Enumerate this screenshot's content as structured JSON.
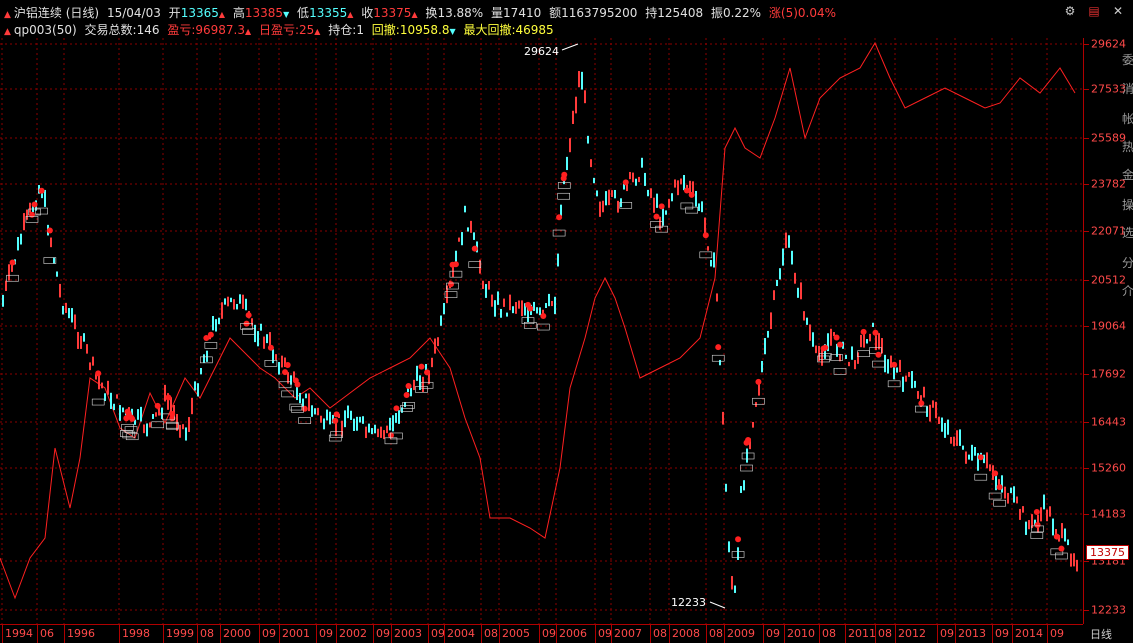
{
  "header": {
    "title": "沪铝连续 (日线)",
    "date": "15/04/03",
    "open_label": "开",
    "open": "13365",
    "high_label": "高",
    "high": "13385",
    "low_label": "低",
    "low": "13355",
    "close_label": "收",
    "close": "13375",
    "turnover_label": "换",
    "turnover": "13.88%",
    "volume_label": "量",
    "volume": "17410",
    "amount_label": "额",
    "amount": "1163795200",
    "oi_label": "持",
    "oi": "125408",
    "amp_label": "振",
    "amp": "0.22%",
    "chg_label": "涨(5)",
    "chg": "0.04%"
  },
  "strategy": {
    "name": "qp003(50)",
    "trades_label": "交易总数:",
    "trades": "146",
    "profit_label": "盈亏:",
    "profit": "96987.3",
    "daily_label": "日盈亏:",
    "daily": "25",
    "position_label": "持仓:",
    "position": "1",
    "drawdown_label": "回撤:",
    "drawdown": "10958.8",
    "maxdd_label": "最大回撤:",
    "maxdd": "46985"
  },
  "colors": {
    "up": "#ff3b3b",
    "down": "#54ffff",
    "equity": "#ff2020",
    "grid": "#8a0000",
    "text": "#ffffff"
  },
  "y_ticks": [
    "29624",
    "27533",
    "25589",
    "23782",
    "22071",
    "20512",
    "19064",
    "17692",
    "16443",
    "15260",
    "14183",
    "13181",
    "12233"
  ],
  "x_ticks": [
    "1994",
    "06",
    "1996",
    "1998",
    "1999",
    "08",
    "2000",
    "09",
    "2001",
    "09",
    "2002",
    "09",
    "2003",
    "09",
    "2004",
    "08",
    "2005",
    "09",
    "2006",
    "09",
    "2007",
    "08",
    "2008",
    "08",
    "2009",
    "09",
    "2010",
    "08",
    "2011",
    "08",
    "2012",
    "09",
    "2013",
    "09",
    "2014",
    "09"
  ],
  "annotations": {
    "peak": "29624",
    "trough": "12233",
    "current": "13375"
  },
  "side_labels": [
    "委",
    "消",
    "帐",
    "热",
    "金",
    "操",
    "选",
    "分",
    "介"
  ],
  "footer": {
    "period": "日线"
  },
  "icons": [
    "settings-icon",
    "calendar-icon",
    "close-icon"
  ]
}
